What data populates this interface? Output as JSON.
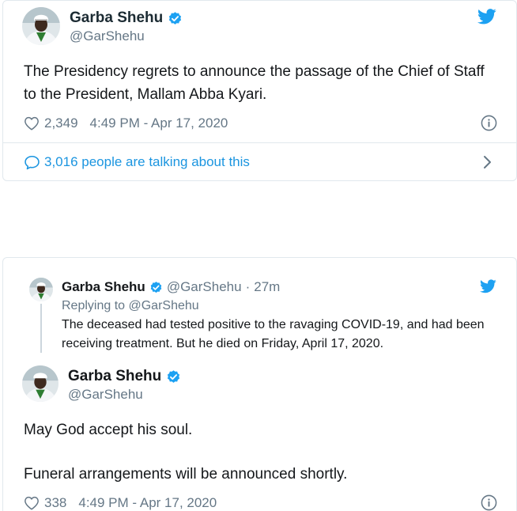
{
  "tweet1": {
    "author_name": "Garba Shehu",
    "author_handle": "@GarShehu",
    "text": "The Presidency regrets to announce the passage of the Chief of Staff to the President, Mallam Abba Kyari.",
    "likes": "2,349",
    "timestamp": "4:49 PM - Apr 17, 2020",
    "talking": "3,016 people are talking about this"
  },
  "tweet2": {
    "parent": {
      "author_name": "Garba Shehu",
      "author_handle": "@GarShehu",
      "separator": "·",
      "age": "27m",
      "replying_to": "Replying to @GarShehu",
      "text": "The deceased had tested positive to the ravaging COVID-19, and had been receiving treatment. But he died on Friday, April 17, 2020."
    },
    "author_name": "Garba Shehu",
    "author_handle": "@GarShehu",
    "text_line1": "May God accept his soul.",
    "text_line2": "Funeral arrangements will be announced shortly.",
    "likes": "338",
    "timestamp": "4:49 PM - Apr 17, 2020"
  },
  "colors": {
    "twitter_blue": "#1da1f2",
    "link_blue": "#1b95e0",
    "text": "#14171a",
    "muted": "#657786",
    "border": "#e1e8ed"
  },
  "icons": [
    "avatar",
    "verified-badge-icon",
    "twitter-bird-icon",
    "heart-icon",
    "info-icon",
    "comment-bubble-icon",
    "chevron-right-icon"
  ]
}
